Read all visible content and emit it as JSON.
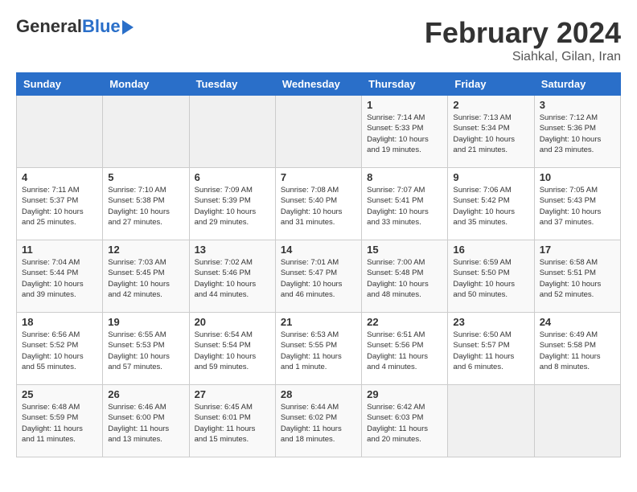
{
  "header": {
    "logo_general": "General",
    "logo_blue": "Blue",
    "month_title": "February 2024",
    "location": "Siahkal, Gilan, Iran"
  },
  "days_of_week": [
    "Sunday",
    "Monday",
    "Tuesday",
    "Wednesday",
    "Thursday",
    "Friday",
    "Saturday"
  ],
  "weeks": [
    [
      {
        "day": "",
        "info": ""
      },
      {
        "day": "",
        "info": ""
      },
      {
        "day": "",
        "info": ""
      },
      {
        "day": "",
        "info": ""
      },
      {
        "day": "1",
        "info": "Sunrise: 7:14 AM\nSunset: 5:33 PM\nDaylight: 10 hours\nand 19 minutes."
      },
      {
        "day": "2",
        "info": "Sunrise: 7:13 AM\nSunset: 5:34 PM\nDaylight: 10 hours\nand 21 minutes."
      },
      {
        "day": "3",
        "info": "Sunrise: 7:12 AM\nSunset: 5:36 PM\nDaylight: 10 hours\nand 23 minutes."
      }
    ],
    [
      {
        "day": "4",
        "info": "Sunrise: 7:11 AM\nSunset: 5:37 PM\nDaylight: 10 hours\nand 25 minutes."
      },
      {
        "day": "5",
        "info": "Sunrise: 7:10 AM\nSunset: 5:38 PM\nDaylight: 10 hours\nand 27 minutes."
      },
      {
        "day": "6",
        "info": "Sunrise: 7:09 AM\nSunset: 5:39 PM\nDaylight: 10 hours\nand 29 minutes."
      },
      {
        "day": "7",
        "info": "Sunrise: 7:08 AM\nSunset: 5:40 PM\nDaylight: 10 hours\nand 31 minutes."
      },
      {
        "day": "8",
        "info": "Sunrise: 7:07 AM\nSunset: 5:41 PM\nDaylight: 10 hours\nand 33 minutes."
      },
      {
        "day": "9",
        "info": "Sunrise: 7:06 AM\nSunset: 5:42 PM\nDaylight: 10 hours\nand 35 minutes."
      },
      {
        "day": "10",
        "info": "Sunrise: 7:05 AM\nSunset: 5:43 PM\nDaylight: 10 hours\nand 37 minutes."
      }
    ],
    [
      {
        "day": "11",
        "info": "Sunrise: 7:04 AM\nSunset: 5:44 PM\nDaylight: 10 hours\nand 39 minutes."
      },
      {
        "day": "12",
        "info": "Sunrise: 7:03 AM\nSunset: 5:45 PM\nDaylight: 10 hours\nand 42 minutes."
      },
      {
        "day": "13",
        "info": "Sunrise: 7:02 AM\nSunset: 5:46 PM\nDaylight: 10 hours\nand 44 minutes."
      },
      {
        "day": "14",
        "info": "Sunrise: 7:01 AM\nSunset: 5:47 PM\nDaylight: 10 hours\nand 46 minutes."
      },
      {
        "day": "15",
        "info": "Sunrise: 7:00 AM\nSunset: 5:48 PM\nDaylight: 10 hours\nand 48 minutes."
      },
      {
        "day": "16",
        "info": "Sunrise: 6:59 AM\nSunset: 5:50 PM\nDaylight: 10 hours\nand 50 minutes."
      },
      {
        "day": "17",
        "info": "Sunrise: 6:58 AM\nSunset: 5:51 PM\nDaylight: 10 hours\nand 52 minutes."
      }
    ],
    [
      {
        "day": "18",
        "info": "Sunrise: 6:56 AM\nSunset: 5:52 PM\nDaylight: 10 hours\nand 55 minutes."
      },
      {
        "day": "19",
        "info": "Sunrise: 6:55 AM\nSunset: 5:53 PM\nDaylight: 10 hours\nand 57 minutes."
      },
      {
        "day": "20",
        "info": "Sunrise: 6:54 AM\nSunset: 5:54 PM\nDaylight: 10 hours\nand 59 minutes."
      },
      {
        "day": "21",
        "info": "Sunrise: 6:53 AM\nSunset: 5:55 PM\nDaylight: 11 hours\nand 1 minute."
      },
      {
        "day": "22",
        "info": "Sunrise: 6:51 AM\nSunset: 5:56 PM\nDaylight: 11 hours\nand 4 minutes."
      },
      {
        "day": "23",
        "info": "Sunrise: 6:50 AM\nSunset: 5:57 PM\nDaylight: 11 hours\nand 6 minutes."
      },
      {
        "day": "24",
        "info": "Sunrise: 6:49 AM\nSunset: 5:58 PM\nDaylight: 11 hours\nand 8 minutes."
      }
    ],
    [
      {
        "day": "25",
        "info": "Sunrise: 6:48 AM\nSunset: 5:59 PM\nDaylight: 11 hours\nand 11 minutes."
      },
      {
        "day": "26",
        "info": "Sunrise: 6:46 AM\nSunset: 6:00 PM\nDaylight: 11 hours\nand 13 minutes."
      },
      {
        "day": "27",
        "info": "Sunrise: 6:45 AM\nSunset: 6:01 PM\nDaylight: 11 hours\nand 15 minutes."
      },
      {
        "day": "28",
        "info": "Sunrise: 6:44 AM\nSunset: 6:02 PM\nDaylight: 11 hours\nand 18 minutes."
      },
      {
        "day": "29",
        "info": "Sunrise: 6:42 AM\nSunset: 6:03 PM\nDaylight: 11 hours\nand 20 minutes."
      },
      {
        "day": "",
        "info": ""
      },
      {
        "day": "",
        "info": ""
      }
    ]
  ]
}
